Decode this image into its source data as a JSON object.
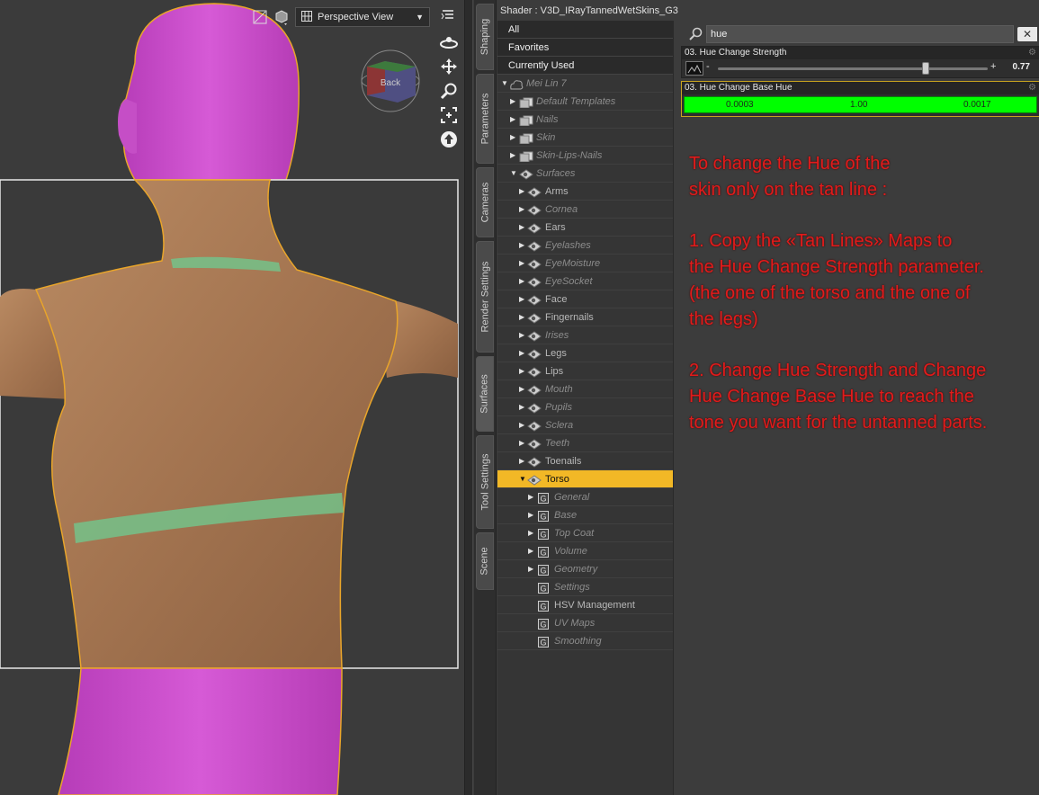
{
  "viewport": {
    "view_label": "Perspective View",
    "nav_cube_face": "Back",
    "icons": [
      "frame-icon",
      "camera-icon",
      "orbit-icon",
      "pan-icon",
      "zoom-icon",
      "frame-selection-icon",
      "reset-view-icon",
      "menu-icon"
    ]
  },
  "side_tabs": [
    "Shaping",
    "Parameters",
    "Cameras",
    "Render Settings",
    "Surfaces",
    "Tool Settings",
    "Scene"
  ],
  "active_tab": "Surfaces",
  "shader_title": "Shader : V3D_IRayTannedWetSkins_G3",
  "tree": {
    "top_items": [
      "All",
      "Favorites",
      "Currently Used"
    ],
    "figure": "Mei Lin 7",
    "groups": [
      "Default Templates",
      "Nails",
      "Skin",
      "Skin-Lips-Nails",
      "Surfaces"
    ],
    "surfaces": [
      {
        "label": "Arms",
        "dim": false
      },
      {
        "label": "Cornea",
        "dim": true
      },
      {
        "label": "Ears",
        "dim": false
      },
      {
        "label": "Eyelashes",
        "dim": true
      },
      {
        "label": "EyeMoisture",
        "dim": true
      },
      {
        "label": "EyeSocket",
        "dim": true
      },
      {
        "label": "Face",
        "dim": false
      },
      {
        "label": "Fingernails",
        "dim": false
      },
      {
        "label": "Irises",
        "dim": true
      },
      {
        "label": "Legs",
        "dim": false
      },
      {
        "label": "Lips",
        "dim": false
      },
      {
        "label": "Mouth",
        "dim": true
      },
      {
        "label": "Pupils",
        "dim": true
      },
      {
        "label": "Sclera",
        "dim": true
      },
      {
        "label": "Teeth",
        "dim": true
      },
      {
        "label": "Toenails",
        "dim": false
      },
      {
        "label": "Torso",
        "dim": false,
        "selected": true
      }
    ],
    "torso_children": [
      {
        "label": "General",
        "dim": true,
        "expandable": true
      },
      {
        "label": "Base",
        "dim": true,
        "expandable": true
      },
      {
        "label": "Top Coat",
        "dim": true,
        "expandable": true
      },
      {
        "label": "Volume",
        "dim": true,
        "expandable": true
      },
      {
        "label": "Geometry",
        "dim": true,
        "expandable": true
      },
      {
        "label": "Settings",
        "dim": true,
        "expandable": false
      },
      {
        "label": "HSV Management",
        "dim": false,
        "expandable": false
      },
      {
        "label": "UV Maps",
        "dim": true,
        "expandable": false
      },
      {
        "label": "Smoothing",
        "dim": true,
        "expandable": false
      }
    ]
  },
  "search": {
    "value": "hue"
  },
  "params": [
    {
      "name": "03. Hue Change Strength",
      "value": "0.77",
      "level": 0.77,
      "minus": "-",
      "plus": "+"
    },
    {
      "name": "03. Hue Change Base Hue",
      "values": [
        "0.0003",
        "1.00",
        "0.0017"
      ],
      "color": "#00ff00"
    }
  ],
  "note": {
    "para1": "To change the Hue of the\nskin only on the tan line :",
    "para2": "1. Copy the «Tan Lines» Maps to\nthe Hue Change Strength parameter.\n(the one of the torso and the one of\nthe legs)",
    "para3": "2. Change Hue Strength and Change\nHue Change Base Hue to reach the\ntone you want for the untanned parts.",
    "color": "#e21b1b"
  }
}
